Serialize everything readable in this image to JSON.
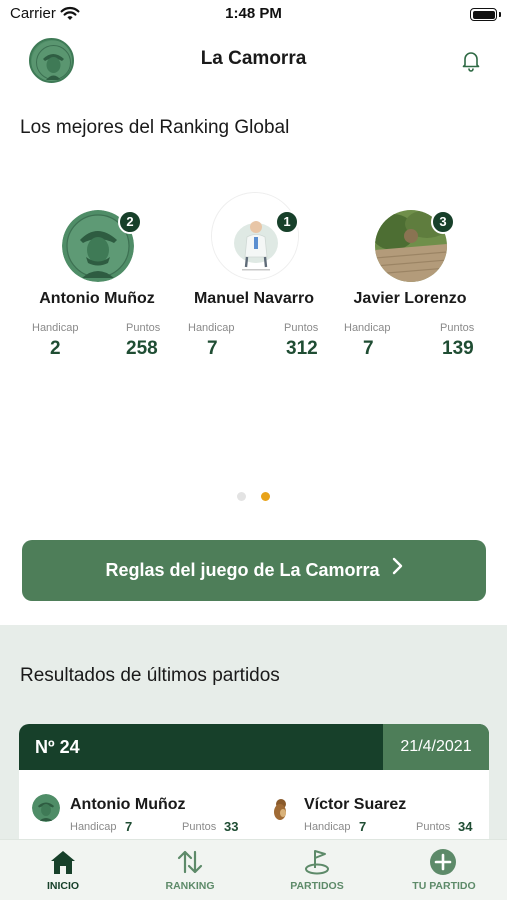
{
  "status_bar": {
    "carrier": "Carrier",
    "time": "1:48 PM"
  },
  "header": {
    "title": "La Camorra"
  },
  "ranking": {
    "title": "Los mejores del Ranking Global",
    "players": [
      {
        "position": "2",
        "name": "Antonio Muñoz",
        "handicap_label": "Handicap",
        "handicap": "2",
        "points_label": "Puntos",
        "points": "258"
      },
      {
        "position": "1",
        "name": "Manuel Navarro",
        "handicap_label": "Handicap",
        "handicap": "7",
        "points_label": "Puntos",
        "points": "312"
      },
      {
        "position": "3",
        "name": "Javier Lorenzo",
        "handicap_label": "Handicap",
        "handicap": "7",
        "points_label": "Puntos",
        "points": "139"
      }
    ],
    "pagination": {
      "pages": 2,
      "active": 2
    }
  },
  "rules_button": {
    "label": "Reglas del juego de La Camorra"
  },
  "results": {
    "title": "Resultados de últimos partidos",
    "match": {
      "number": "Nº 24",
      "date": "21/4/2021",
      "players": [
        {
          "name": "Antonio Muñoz",
          "handicap_label": "Handicap",
          "handicap": "7",
          "points_label": "Puntos",
          "points": "33"
        },
        {
          "name": "Víctor Suarez",
          "handicap_label": "Handicap",
          "handicap": "7",
          "points_label": "Puntos",
          "points": "34"
        }
      ]
    }
  },
  "tab_bar": {
    "tabs": [
      {
        "label": "INICIO",
        "icon": "home-icon",
        "active": true
      },
      {
        "label": "RANKING",
        "icon": "sort-arrows-icon",
        "active": false
      },
      {
        "label": "PARTIDOS",
        "icon": "golf-flag-icon",
        "active": false
      },
      {
        "label": "TU PARTIDO",
        "icon": "add-circle-icon",
        "active": false
      }
    ]
  },
  "colors": {
    "primary_dark": "#17402a",
    "primary": "#4e7e59",
    "accent_dot": "#e8a31a",
    "tab_inactive": "#5d8a69",
    "results_bg": "#e7ede9"
  }
}
